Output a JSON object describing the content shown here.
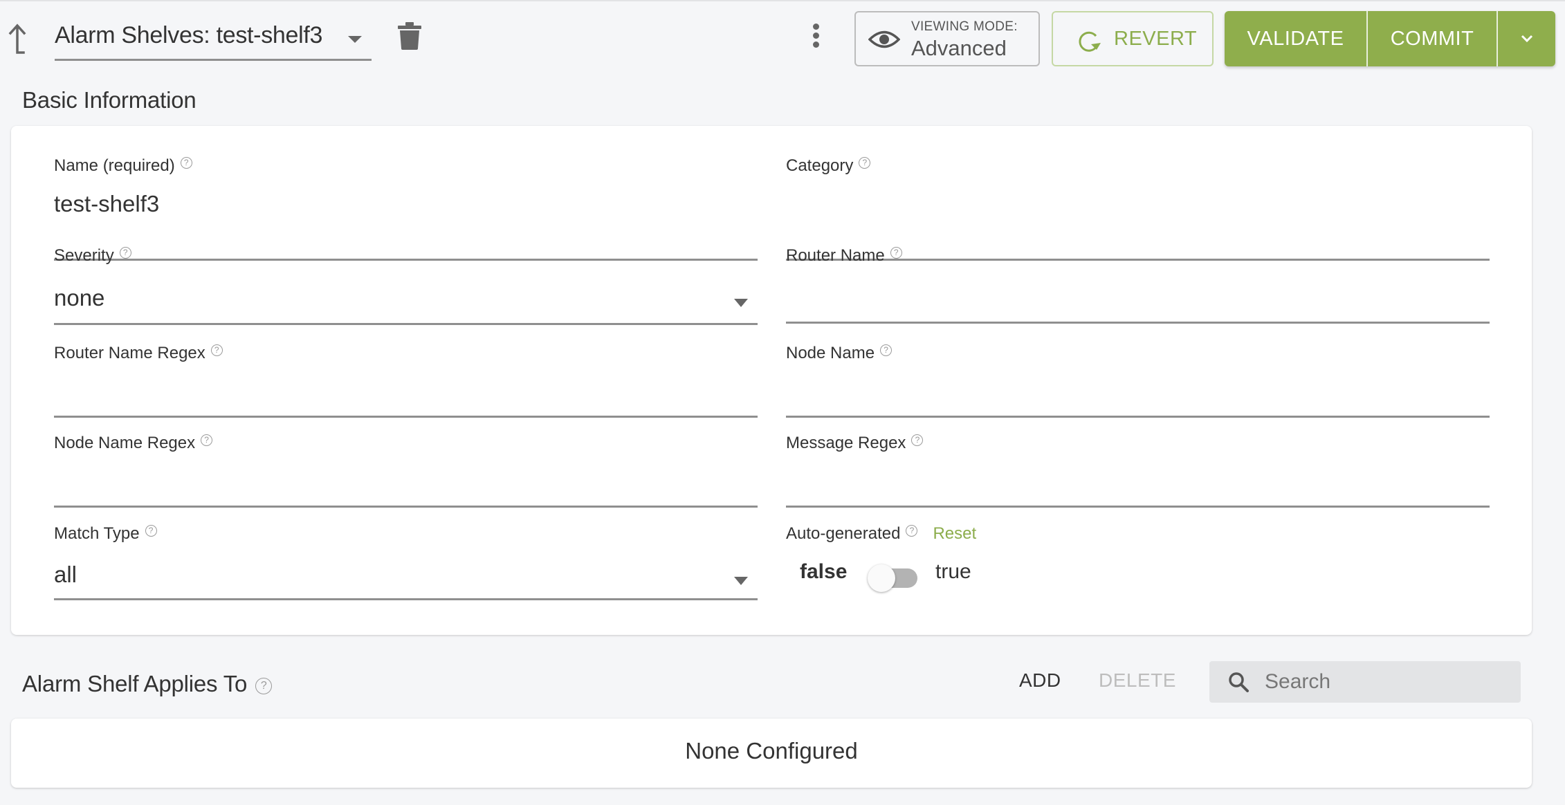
{
  "header": {
    "breadcrumb": "Alarm Shelves: test-shelf3",
    "viewing_mode_label": "VIEWING MODE:",
    "viewing_mode_value": "Advanced",
    "revert_label": "REVERT",
    "validate_label": "VALIDATE",
    "commit_label": "COMMIT"
  },
  "basic_info": {
    "title": "Basic Information",
    "help_glyph": "?",
    "fields": {
      "name": {
        "label": "Name (required)",
        "value": "test-shelf3"
      },
      "category": {
        "label": "Category",
        "value": ""
      },
      "severity": {
        "label": "Severity",
        "value": "none"
      },
      "router_name": {
        "label": "Router Name",
        "value": ""
      },
      "router_name_regex": {
        "label": "Router Name Regex",
        "value": ""
      },
      "node_name": {
        "label": "Node Name",
        "value": ""
      },
      "node_name_regex": {
        "label": "Node Name Regex",
        "value": ""
      },
      "message_regex": {
        "label": "Message Regex",
        "value": ""
      },
      "match_type": {
        "label": "Match Type",
        "value": "all"
      },
      "auto_generated": {
        "label": "Auto-generated",
        "reset_label": "Reset",
        "false_label": "false",
        "true_label": "true",
        "value": false
      }
    }
  },
  "applies_to": {
    "title": "Alarm Shelf Applies To",
    "add_label": "ADD",
    "delete_label": "DELETE",
    "search_placeholder": "Search",
    "empty_message": "None Configured"
  },
  "colors": {
    "accent": "#8fae4c",
    "background": "#f5f6f8"
  }
}
